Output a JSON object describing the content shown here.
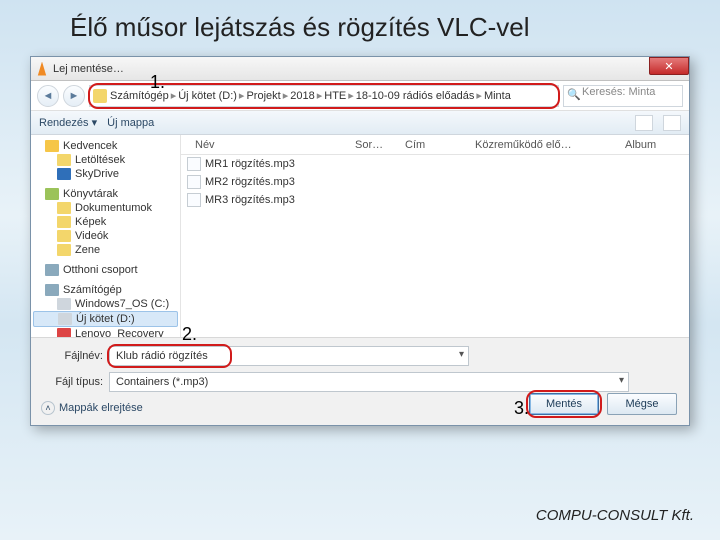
{
  "slide": {
    "title": "Élő műsor lejátszás és rögzítés VLC-vel",
    "footer": "COMPU-CONSULT Kft."
  },
  "callouts": {
    "one": "1.",
    "two": "2.",
    "three": "3."
  },
  "titlebar": {
    "text": "Lej mentése…",
    "close": "✕"
  },
  "nav": {
    "back": "◄",
    "fwd": "►",
    "crumbs": [
      "Számítógép",
      "Új kötet (D:)",
      "Projekt",
      "2018",
      "HTE",
      "18-10-09 rádiós előadás",
      "Minta"
    ],
    "search_placeholder": "Keresés: Minta"
  },
  "toolbar": {
    "organize": "Rendezés ▾",
    "newfolder": "Új mappa"
  },
  "columns": {
    "name": "Név",
    "num": "Sor…",
    "title": "Cím",
    "artists": "Közreműködő elő…",
    "album": "Album"
  },
  "tree": {
    "favorites": "Kedvencek",
    "downloads": "Letöltések",
    "skydrive": "SkyDrive",
    "libraries": "Könyvtárak",
    "documents": "Dokumentumok",
    "pictures": "Képek",
    "videos": "Videók",
    "music": "Zene",
    "homegroup": "Otthoni csoport",
    "computer": "Számítógép",
    "cdrive": "Windows7_OS (C:)",
    "ddrive": "Új kötet (D:)",
    "recovery": "Lenovo_Recovery"
  },
  "files": [
    "MR1 rögzítés.mp3",
    "MR2 rögzítés.mp3",
    "MR3 rögzítés.mp3"
  ],
  "form": {
    "filename_label": "Fájlnév:",
    "filename_value": "Klub rádió rögzítés",
    "type_label": "Fájl típus:",
    "type_value": "Containers (*.mp3)",
    "hide": "Mappák elrejtése",
    "save": "Mentés",
    "cancel": "Mégse"
  }
}
